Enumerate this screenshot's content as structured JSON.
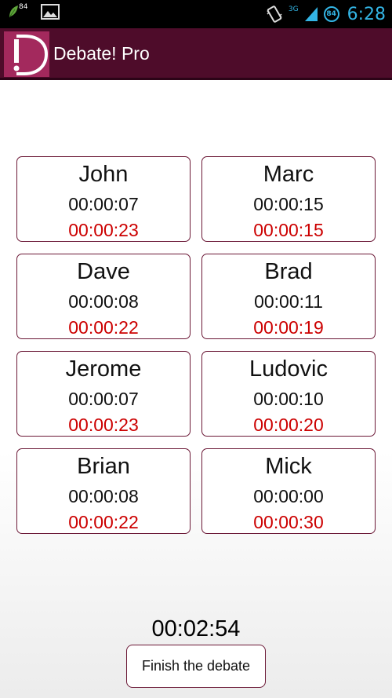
{
  "status_bar": {
    "notification_count": "84",
    "network_type": "3G",
    "battery_level": "84",
    "time": "6:28",
    "icons": [
      "leaf-icon",
      "gallery-icon",
      "vibrate-icon",
      "signal-icon",
      "battery-icon"
    ]
  },
  "action_bar": {
    "logo_text": "!",
    "title": "Debate! Pro",
    "background_color": "#4e0c2a"
  },
  "speakers": [
    {
      "name": "John",
      "elapsed": "00:00:07",
      "remaining": "00:00:23"
    },
    {
      "name": "Marc",
      "elapsed": "00:00:15",
      "remaining": "00:00:15"
    },
    {
      "name": "Dave",
      "elapsed": "00:00:08",
      "remaining": "00:00:22"
    },
    {
      "name": "Brad",
      "elapsed": "00:00:11",
      "remaining": "00:00:19"
    },
    {
      "name": "Jerome",
      "elapsed": "00:00:07",
      "remaining": "00:00:23"
    },
    {
      "name": "Ludovic",
      "elapsed": "00:00:10",
      "remaining": "00:00:20"
    },
    {
      "name": "Brian",
      "elapsed": "00:00:08",
      "remaining": "00:00:22"
    },
    {
      "name": "Mick",
      "elapsed": "00:00:00",
      "remaining": "00:00:30"
    }
  ],
  "colors": {
    "remaining_text": "#cc0000",
    "card_border": "#6b1836",
    "status_accent": "#33b5e5"
  },
  "total_time": "00:02:54",
  "finish_button_label": "Finish the debate"
}
